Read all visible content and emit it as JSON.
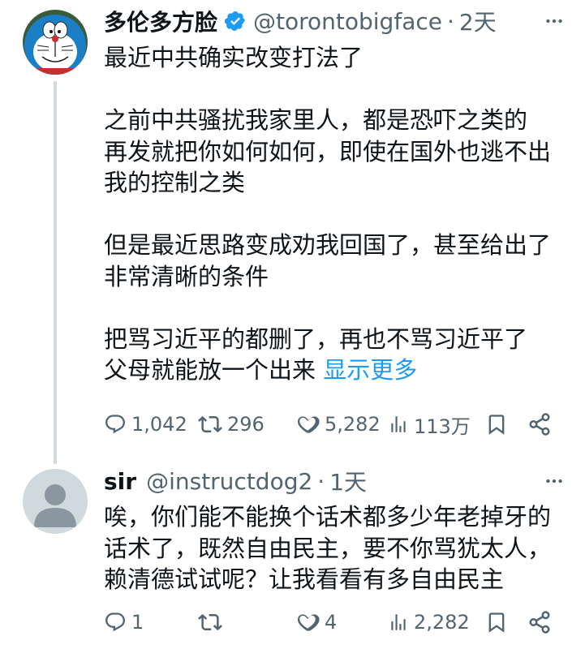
{
  "tweet1": {
    "display_name": "多伦多方脸",
    "handle": "@torontobigface",
    "separator": "·",
    "time": "2天",
    "text": "最近中共确实改变打法了\n\n之前中共骚扰我家里人，都是恐吓之类的\n再发就把你如何如何，即使在国外也逃不出\n我的控制之类\n\n但是最近思路变成劝我回国了，甚至给出了\n非常清晰的条件\n\n把骂习近平的都删了，再也不骂习近平了\n父母就能放一个出来 ",
    "show_more": "显示更多",
    "replies": "1,042",
    "retweets": "296",
    "likes": "5,282",
    "views": "113万"
  },
  "tweet2": {
    "display_name": "sir",
    "handle": "@instructdog2",
    "separator": "·",
    "time": "1天",
    "text": "唉，你们能不能换个话术都多少年老掉牙的\n话术了，既然自由民主，要不你骂犹太人，\n赖清德试试呢？让我看看有多自由民主",
    "replies": "1",
    "retweets": "",
    "likes": "4",
    "views": "2,282"
  },
  "colors": {
    "text": "#0f1419",
    "secondary": "#536471",
    "link": "#1d9bf0",
    "verified": "#1d9bf0"
  },
  "icons": [
    "verified-badge-icon",
    "more-icon",
    "reply-icon",
    "retweet-icon",
    "like-icon",
    "views-icon",
    "bookmark-icon",
    "share-icon"
  ]
}
